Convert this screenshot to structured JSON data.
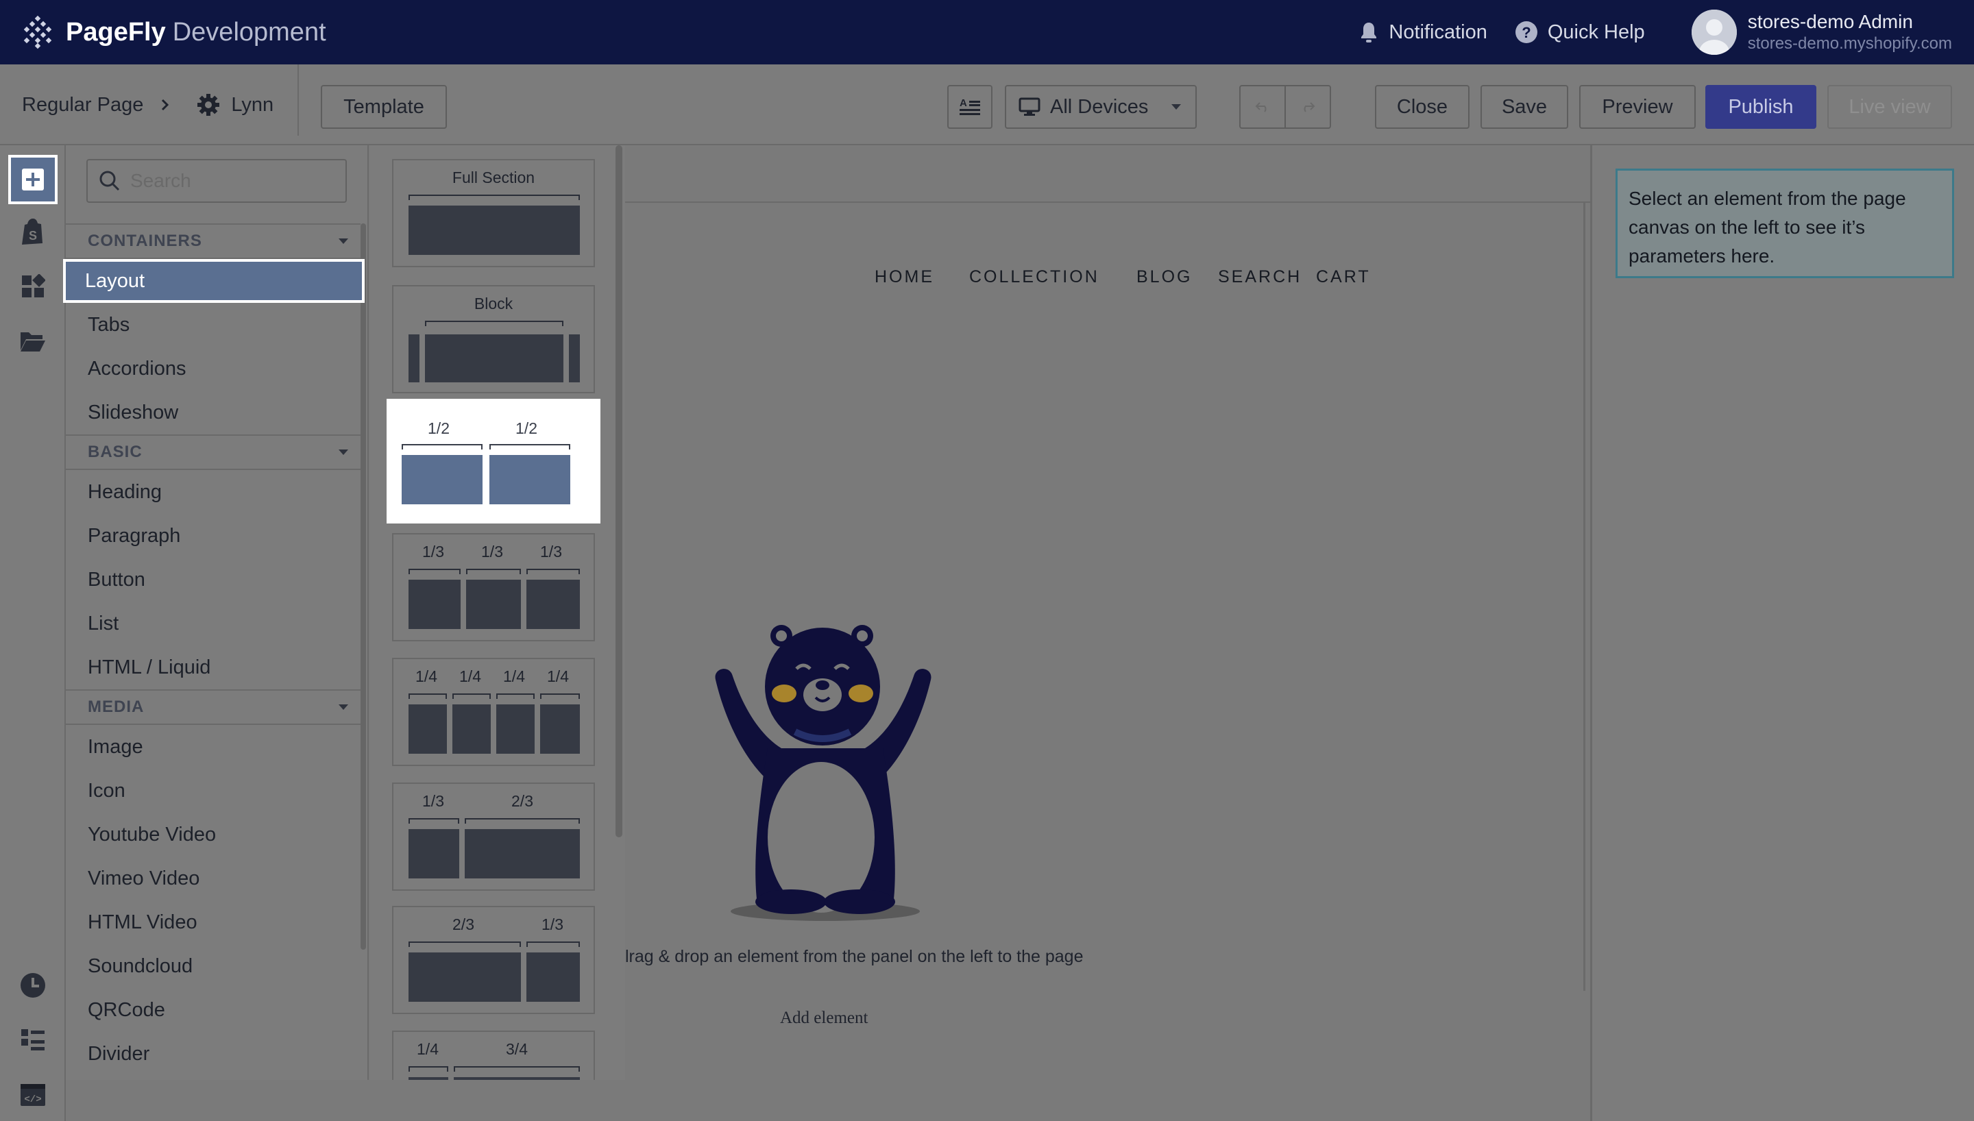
{
  "app": {
    "brand": "PageFly",
    "environment": "Development"
  },
  "topbar": {
    "notification": "Notification",
    "help": "Quick Help",
    "account_name": "stores-demo Admin",
    "account_domain": "stores-demo.myshopify.com"
  },
  "toolbar": {
    "page_type": "Regular Page",
    "page_name": "Lynn",
    "template": "Template",
    "devices": "All Devices",
    "close": "Close",
    "save": "Save",
    "preview": "Preview",
    "publish": "Publish",
    "live_view": "Live view"
  },
  "elements": {
    "search_placeholder": "Search",
    "groups": [
      {
        "title": "CONTAINERS",
        "items": [
          "Layout",
          "Tabs",
          "Accordions",
          "Slideshow"
        ]
      },
      {
        "title": "BASIC",
        "items": [
          "Heading",
          "Paragraph",
          "Button",
          "List",
          "HTML / Liquid"
        ]
      },
      {
        "title": "MEDIA",
        "items": [
          "Image",
          "Icon",
          "Youtube Video",
          "Vimeo Video",
          "HTML Video",
          "Soundcloud",
          "QRCode",
          "Divider"
        ]
      }
    ],
    "selected": "Layout"
  },
  "layouts": {
    "full_section": "Full Section",
    "block": "Block",
    "half_a": "1/2",
    "half_b": "1/2",
    "third_a": "1/3",
    "third_b": "1/3",
    "third_c": "1/3",
    "quarter_a": "1/4",
    "quarter_b": "1/4",
    "quarter_c": "1/4",
    "quarter_d": "1/4",
    "one_two_a": "1/3",
    "one_two_b": "2/3",
    "two_one_a": "2/3",
    "two_one_b": "1/3",
    "one_three_a": "1/4",
    "one_three_b": "3/4"
  },
  "canvas": {
    "nav": [
      "HOME",
      "COLLECTION",
      "BLOG",
      "SEARCH",
      "CART"
    ],
    "empty_message": "lrag & drop an element from the panel on the left to the page",
    "add_element": "Add element"
  },
  "settings": {
    "hint": "Select an element from the page canvas on the left to see it’s parameters here."
  },
  "colors": {
    "navbar": "#0e1642",
    "selected": "#5a6f91",
    "publish": "#333a8a",
    "mascot": "#0f0f3a",
    "cheek": "#a8842c"
  }
}
